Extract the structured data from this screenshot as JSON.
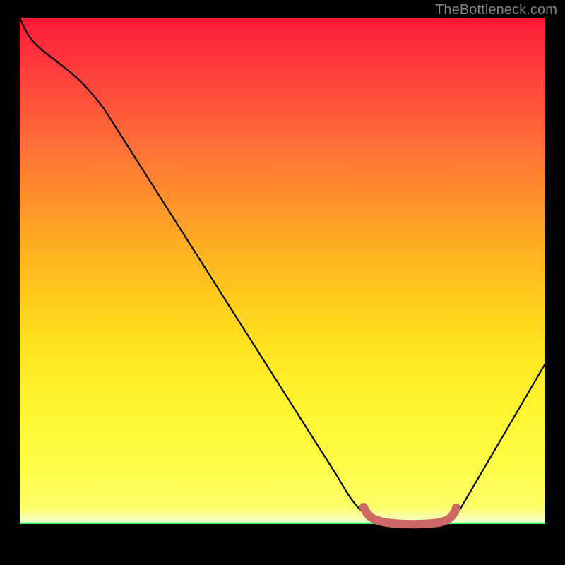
{
  "watermark": "TheBottleneck.com",
  "chart_data": {
    "type": "line",
    "title": "",
    "xlabel": "",
    "ylabel": "",
    "xlim": [
      0,
      1
    ],
    "ylim": [
      0,
      1
    ],
    "series": [
      {
        "name": "bottleneck-curve",
        "points": [
          {
            "x": 0.0,
            "y": 1.0
          },
          {
            "x": 0.03,
            "y": 0.95
          },
          {
            "x": 0.07,
            "y": 0.93
          },
          {
            "x": 0.12,
            "y": 0.9
          },
          {
            "x": 0.23,
            "y": 0.74
          },
          {
            "x": 0.39,
            "y": 0.49
          },
          {
            "x": 0.53,
            "y": 0.26
          },
          {
            "x": 0.605,
            "y": 0.12
          },
          {
            "x": 0.64,
            "y": 0.06
          },
          {
            "x": 0.67,
            "y": 0.02
          },
          {
            "x": 0.7,
            "y": 0.005
          },
          {
            "x": 0.75,
            "y": 0.002
          },
          {
            "x": 0.8,
            "y": 0.005
          },
          {
            "x": 0.83,
            "y": 0.02
          },
          {
            "x": 0.87,
            "y": 0.08
          },
          {
            "x": 0.94,
            "y": 0.22
          },
          {
            "x": 1.0,
            "y": 0.36
          }
        ]
      },
      {
        "name": "optimal-marker",
        "color": "#cc6866",
        "points": [
          {
            "x": 0.655,
            "y": 0.028
          },
          {
            "x": 0.665,
            "y": 0.012
          },
          {
            "x": 0.69,
            "y": 0.006
          },
          {
            "x": 0.74,
            "y": 0.003
          },
          {
            "x": 0.79,
            "y": 0.006
          },
          {
            "x": 0.815,
            "y": 0.012
          },
          {
            "x": 0.828,
            "y": 0.026
          }
        ]
      }
    ],
    "background_gradient": {
      "top": "#fe1736",
      "mid": "#ffe11f",
      "bottom": "#00ff2a"
    }
  }
}
